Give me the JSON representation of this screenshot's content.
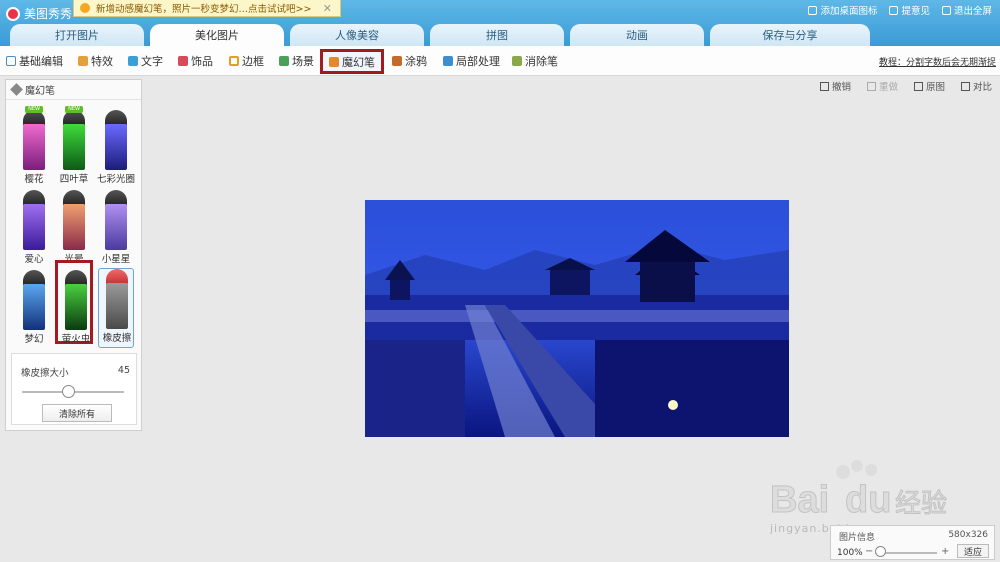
{
  "app": {
    "title": "美图秀秀"
  },
  "notice": {
    "text": "新增动感魔幻笔，照片一秒变梦幻…点击试试吧>>",
    "close": "✕"
  },
  "top_links": [
    "添加桌面图标",
    "提意见",
    "退出全屏"
  ],
  "tabs": [
    {
      "label": "打开图片",
      "active": false
    },
    {
      "label": "美化图片",
      "active": true
    },
    {
      "label": "人像美容",
      "active": false
    },
    {
      "label": "拼图",
      "active": false
    },
    {
      "label": "动画",
      "active": false
    },
    {
      "label": "保存与分享",
      "active": false
    }
  ],
  "tools": [
    {
      "label": "基础编辑",
      "color": "#4a8cc9"
    },
    {
      "label": "特效",
      "color": "#e2a13a"
    },
    {
      "label": "文字",
      "color": "#3aa0d6"
    },
    {
      "label": "饰品",
      "color": "#d8495a"
    },
    {
      "label": "边框",
      "color": "#e0a020"
    },
    {
      "label": "场景",
      "color": "#4a9f5a"
    },
    {
      "label": "魔幻笔",
      "color": "#e28a2a",
      "selected": true
    },
    {
      "label": "涂鸦",
      "color": "#c46a2a"
    },
    {
      "label": "局部处理",
      "color": "#3b8fd0"
    },
    {
      "label": "消除笔",
      "color": "#8aa84a"
    }
  ],
  "tutorial": "教程：分割字数后会无期渐捉",
  "panel": {
    "title": "魔幻笔",
    "new_badge": "NEW",
    "pens": [
      {
        "label": "樱花",
        "new": true,
        "color1": "#f06ad0",
        "color2": "#7a1e7a"
      },
      {
        "label": "四叶草",
        "new": true,
        "color1": "#3fdc3a",
        "color2": "#0d5a18"
      },
      {
        "label": "七彩光圈",
        "new": false,
        "color1": "#6a6aff",
        "color2": "#1c1c7a"
      },
      {
        "label": "爱心",
        "new": false,
        "color1": "#a070f0",
        "color2": "#3a1a9a"
      },
      {
        "label": "光晕",
        "new": false,
        "color1": "#f0a070",
        "color2": "#8a2a4a"
      },
      {
        "label": "小星星",
        "new": false,
        "color1": "#b090f0",
        "color2": "#4a3aa0"
      },
      {
        "label": "梦幻",
        "new": false,
        "color1": "#5aa8f0",
        "color2": "#12307a"
      },
      {
        "label": "萤火虫",
        "new": false,
        "color1": "#4ad040",
        "color2": "#0a3a10",
        "highlighted": true
      },
      {
        "label": "橡皮擦",
        "new": false,
        "color1": "#9a9a9a",
        "color2": "#4a4a4a",
        "eraser": true
      }
    ],
    "eraser_size_label": "橡皮擦大小",
    "eraser_size_value": "45",
    "eraser_size_fraction": 0.45,
    "clear_all": "清除所有"
  },
  "actions": [
    {
      "label": "撤销",
      "enabled": true
    },
    {
      "label": "重做",
      "enabled": false
    },
    {
      "label": "原图",
      "enabled": true
    },
    {
      "label": "对比",
      "enabled": true
    }
  ],
  "info": {
    "title": "图片信息",
    "dimensions": "580x326",
    "zoom": "100%",
    "zoom_fraction": 0.0,
    "fit": "适应"
  },
  "watermark": {
    "logo": "Baidu经验",
    "url": "jingyan.baidu.com"
  }
}
